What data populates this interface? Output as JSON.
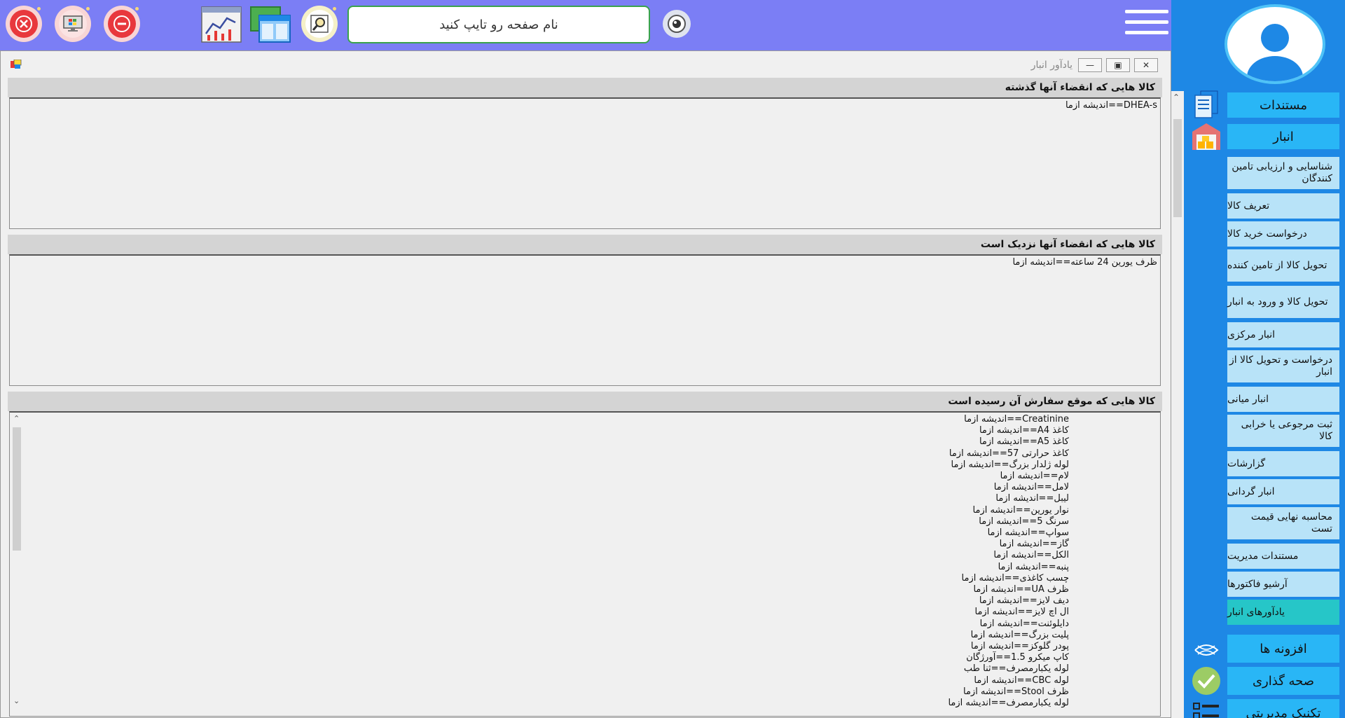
{
  "toolbar": {
    "search_placeholder": "نام صفحه رو تایپ کنید",
    "colors": {
      "close": "#e8383d",
      "minimize": "#e8383d",
      "accent": "#7b7ef5"
    }
  },
  "window": {
    "title": "یادآور انبار",
    "sections": [
      {
        "header": "کالا هایی که انقضاء آنها گذشته",
        "items": [
          "DHEA-s==اندیشه ازما"
        ]
      },
      {
        "header": "کالا هایی که انقضاء آنها نزدیک است",
        "items": [
          "ظرف یورین 24 ساعته==اندیشه ازما"
        ]
      },
      {
        "header": "کالا هایی که موقع سفارش آن رسیده است",
        "items": [
          "Creatinine==اندیشه ازما",
          "کاغذ A4==اندیشه ازما",
          "کاغذ A5==اندیشه ازما",
          "کاغذ حرارتی 57==اندیشه ازما",
          "لوله ژلدار بزرگ==اندیشه ازما",
          "لام==اندیشه ازما",
          "لامل==اندیشه ازما",
          "لیبل==اندیشه ازما",
          "نوار یورین==اندیشه ازما",
          "سرنگ 5==اندیشه ازما",
          "سواپ==اندیشه ازما",
          "گاز==اندیشه ازما",
          "الکل==اندیشه ازما",
          "پنبه==اندیشه ازما",
          "چسب کاغذی==اندیشه ازما",
          "ظرف UA==اندیشه ازما",
          "دیف لایز==اندیشه ازما",
          "ال اچ لایز==اندیشه ازما",
          "دایلوئنت==اندیشه ازما",
          "پلیت بزرگ==اندیشه ازما",
          "پودر گلوکز==اندیشه ازما",
          "کاپ میکرو 1.5==آورژگان",
          "لوله یکبارمصرف==ثنا طب",
          "لوله CBC==اندیشه ازما",
          "ظرف Stool==اندیشه ازما",
          "لوله یکبارمصرف==اندیشه ازما"
        ]
      }
    ]
  },
  "sidebar": {
    "top_items": [
      {
        "label": "مستندات"
      },
      {
        "label": "انبار"
      }
    ],
    "sub_items": [
      "شناسایی و ارزیابی تامین کنندگان",
      "تعریف کالا",
      "درخواست خرید کالا",
      "تحویل کالا از تامین کننده",
      "تحویل کالا و ورود به انبار",
      "انبار مرکزی",
      "درخواست و تحویل کالا از انبار",
      "انبار میانی",
      "ثبت مرجوعی یا خرابی کالا",
      "گزارشات",
      "انبار گردانی",
      "محاسبه نهایی قیمت تست",
      "مستندات مدیریت",
      "آرشیو فاکتورها",
      "یادآورهای انبار"
    ],
    "bottom_items": [
      {
        "label": "افزونه ها"
      },
      {
        "label": "صحه گذاری"
      },
      {
        "label": "تکنیک مدیریتی"
      }
    ]
  }
}
